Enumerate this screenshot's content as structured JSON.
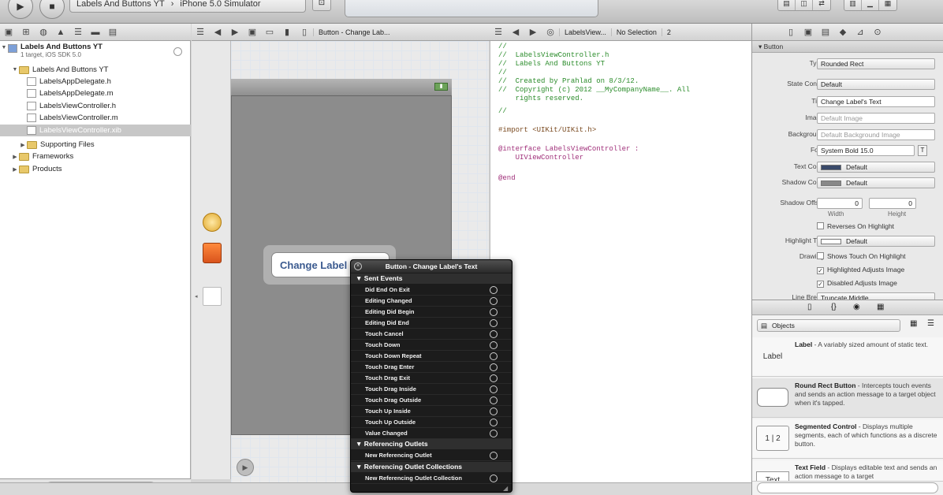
{
  "toolbar": {
    "scheme_label": "Labels And Buttons YT",
    "destination_label": "iPhone 5.0 Simulator",
    "run_icon": "play-icon",
    "stop_icon": "stop-icon"
  },
  "jumpbar": {
    "ib_crumb": "Button - Change Lab...",
    "code_crumb": "LabelsView...",
    "selection": "No Selection",
    "counter": "2"
  },
  "navigator": {
    "project_name": "Labels And Buttons YT",
    "project_sub": "1 target, iOS SDK 5.0",
    "items": [
      {
        "label": "Labels And Buttons YT",
        "kind": "folder"
      },
      {
        "label": "LabelsAppDelegate.h",
        "kind": "file"
      },
      {
        "label": "LabelsAppDelegate.m",
        "kind": "file"
      },
      {
        "label": "LabelsViewController.h",
        "kind": "file"
      },
      {
        "label": "LabelsViewController.m",
        "kind": "file"
      },
      {
        "label": "LabelsViewController.xib",
        "kind": "file"
      },
      {
        "label": "Supporting Files",
        "kind": "folder"
      },
      {
        "label": "Frameworks",
        "kind": "folder"
      },
      {
        "label": "Products",
        "kind": "folder"
      }
    ]
  },
  "canvas": {
    "button_label": "Change Label"
  },
  "code": {
    "lines": [
      "//",
      "//  LabelsViewController.h",
      "//  Labels And Buttons YT",
      "//",
      "//  Created by Prahlad on 8/3/12.",
      "//  Copyright (c) 2012 __MyCompanyName__. All",
      "    rights reserved.",
      "//",
      "",
      "#import <UIKit/UIKit.h>",
      "",
      "@interface LabelsViewController :",
      "    UIViewController",
      "",
      "@end"
    ]
  },
  "inspector": {
    "section": "Button",
    "type_label": "Type",
    "type_value": "Rounded Rect",
    "state_label": "State Config",
    "state_value": "Default",
    "title_label": "Title",
    "title_value": "Change Label's Text",
    "image_label": "Image",
    "image_value": "Default Image",
    "bg_label": "Background",
    "bg_value": "Default Background Image",
    "font_label": "Font",
    "font_value": "System Bold 15.0",
    "textcolor_label": "Text Color",
    "textcolor_value": "Default",
    "shadowcolor_label": "Shadow Color",
    "shadowcolor_value": "Default",
    "shadowoffset_label": "Shadow Offset",
    "shadow_w": "0",
    "shadow_h": "0",
    "width_label": "Width",
    "height_label": "Height",
    "reverses_label": "Reverses On Highlight",
    "highlight_label": "Highlight Tint",
    "highlight_value": "Default",
    "drawing_label": "Drawing",
    "shows_touch_label": "Shows Touch On Highlight",
    "adjusts_label": "Highlighted Adjusts Image",
    "disabled_label": "Disabled Adjusts Image",
    "line_break_label": "Line Break",
    "line_break_value": "Truncate Middle"
  },
  "library": {
    "filter_value": "Objects",
    "items": [
      {
        "thumb": "Label",
        "name": "Label",
        "desc": " - A variably sized amount of static text."
      },
      {
        "thumb": "",
        "name": "Round Rect Button",
        "desc": " - Intercepts touch events and sends an action message to a target object when it's tapped."
      },
      {
        "thumb": "1 | 2",
        "name": "Segmented Control",
        "desc": " - Displays multiple segments, each of which functions as a discrete button."
      },
      {
        "thumb": "Text",
        "name": "Text Field",
        "desc": " - Displays editable text and sends an action message to a target"
      }
    ]
  },
  "popover": {
    "title": "Button - Change Label's Text",
    "sent_events_header": "Sent Events",
    "events": [
      "Did End On Exit",
      "Editing Changed",
      "Editing Did Begin",
      "Editing Did End",
      "Touch Cancel",
      "Touch Down",
      "Touch Down Repeat",
      "Touch Drag Enter",
      "Touch Drag Exit",
      "Touch Drag Inside",
      "Touch Drag Outside",
      "Touch Up Inside",
      "Touch Up Outside",
      "Value Changed"
    ],
    "ref_outlets_header": "Referencing Outlets",
    "new_ref_outlet": "New Referencing Outlet",
    "ref_collections_header": "Referencing Outlet Collections",
    "new_ref_collection": "New Referencing Outlet Collection"
  }
}
